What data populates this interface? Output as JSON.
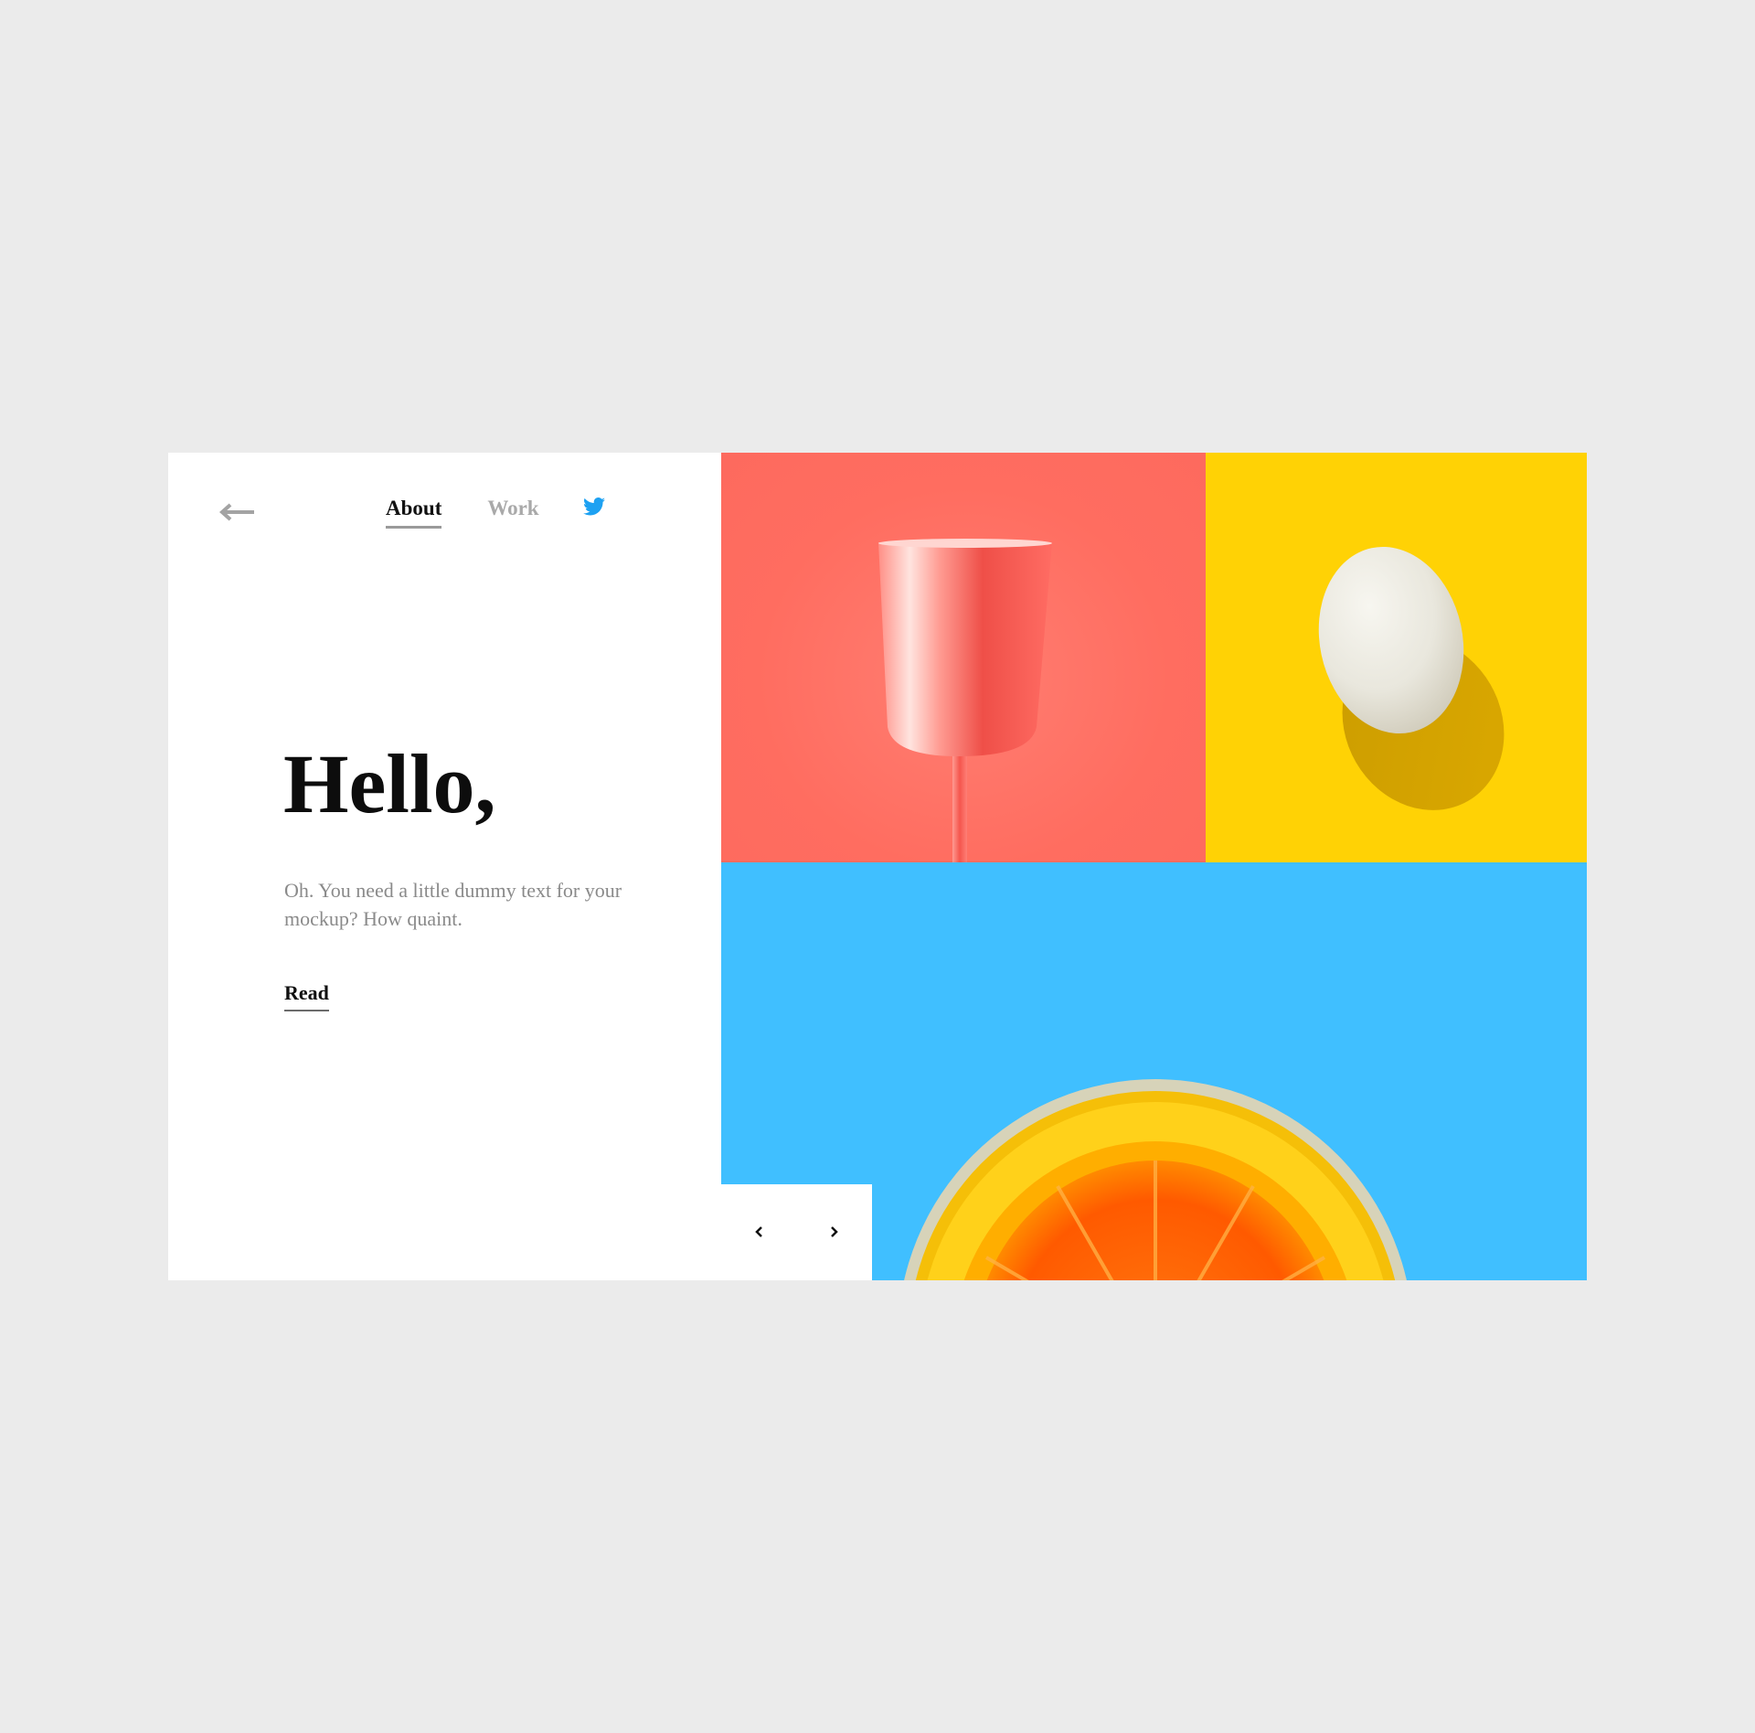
{
  "nav": {
    "back_icon": "arrow-left-icon",
    "links": [
      {
        "label": "About",
        "active": true
      },
      {
        "label": "Work",
        "active": false
      }
    ],
    "social_icon": "twitter-icon"
  },
  "hero": {
    "title": "Hello,",
    "body": "Oh. You need a little dummy text for your mockup? How quaint.",
    "cta_label": "Read"
  },
  "gallery": {
    "tiles": [
      {
        "subject": "pink-goblet-image",
        "background": "#ff7265"
      },
      {
        "subject": "egg-image",
        "background": "#ffd205"
      },
      {
        "subject": "orange-slice-image",
        "background": "#40bfff"
      }
    ],
    "controls": {
      "prev_icon": "chevron-left-icon",
      "next_icon": "chevron-right-icon"
    }
  },
  "colors": {
    "page_background": "#ebebeb",
    "twitter_blue": "#1da1f2",
    "muted_text": "#8a8a8a"
  }
}
